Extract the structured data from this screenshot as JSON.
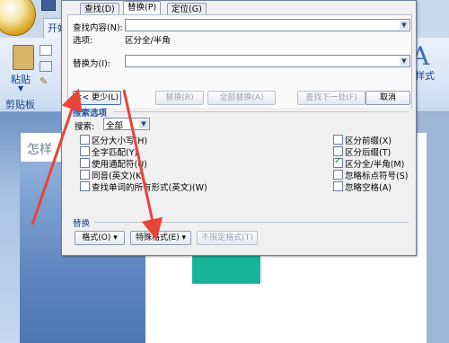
{
  "word": {
    "ribbon_tab": "开始",
    "paste_label": "粘贴",
    "clipboard_group": "剪贴板",
    "style_letter": "A",
    "style_label": "样式",
    "doc_heading": "怎样"
  },
  "dialog": {
    "tabs": [
      "查找(D)",
      "替换(P)",
      "定位(G)"
    ],
    "find_label": "查找内容(N):",
    "options_label": "选项:",
    "options_value": "区分全/半角",
    "replace_label": "替换为(I):",
    "buttons": {
      "less": "<< 更少(L)",
      "replace": "替换(R)",
      "replace_all": "全部替换(A)",
      "find_next": "查找下一处(F)",
      "cancel": "取消"
    },
    "search_options_title": "搜索选项",
    "search_label": "搜索:",
    "search_value": "全部",
    "left_options": [
      {
        "label": "区分大小写(H)",
        "checked": false
      },
      {
        "label": "全字匹配(Y)",
        "checked": false
      },
      {
        "label": "使用通配符(U)",
        "checked": false
      },
      {
        "label": "同音(英文)(K)",
        "checked": false
      },
      {
        "label": "查找单词的所有形式(英文)(W)",
        "checked": false
      }
    ],
    "right_options": [
      {
        "label": "区分前缀(X)",
        "checked": false
      },
      {
        "label": "区分后缀(T)",
        "checked": false
      },
      {
        "label": "区分全/半角(M)",
        "checked": true
      },
      {
        "label": "忽略标点符号(S)",
        "checked": false
      },
      {
        "label": "忽略空格(A)",
        "checked": false
      }
    ],
    "replace_section_title": "替换",
    "bottom_buttons": {
      "format": "格式(O) ▾",
      "special": "特殊格式(E) ▾",
      "no_format": "不限定格式(T)"
    }
  },
  "colors": {
    "annotation_arrow": "#e8443a",
    "accent_blue": "#2053a8",
    "teal": "#17b39b"
  }
}
